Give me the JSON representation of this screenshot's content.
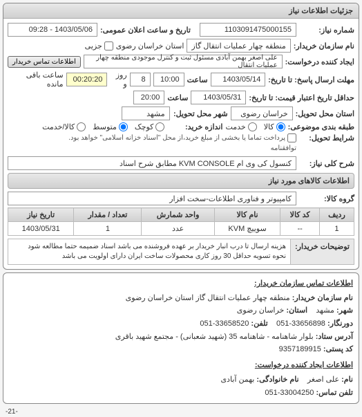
{
  "panel": {
    "title": "جزئیات اطلاعات نیاز"
  },
  "header": {
    "requestNumberLabel": "شماره نیاز:",
    "requestNumber": "1103091475000155",
    "announceDateLabel": "تاریخ و ساعت اعلان عمومی:",
    "announceDate": "1403/05/06 - 09:28",
    "buyerNameLabel": "نام سازمان خریدار:",
    "buyerName": "منطقه چهار عملیات انتقال گاز",
    "provinceLabel": "استان خراسان رضوی",
    "partialCheckbox": "جزیی",
    "requesterLabel": "ایجاد کننده درخواست:",
    "requester": "علی اصغر بهمن آبادی مسئول ثبت و کنترل موجودی منطقه چهار عملیات انتقال",
    "contactBtn": "اطلاعات تماس خریدار",
    "responseDeadlineLabel": "مهلت ارسال پاسخ: تا تاریخ:",
    "responseDeadlineDate": "1403/05/14",
    "timeLabel": "ساعت",
    "responseDeadlineTime": "10:00",
    "dayWord": "روز و",
    "dayValue": "8",
    "remainingTime": "00:20:20",
    "remainingLabel": "ساعت باقی مانده",
    "validityLabel": "حداقل تاریخ اعتبار قیمت: تا تاریخ:",
    "validityDate": "1403/05/31",
    "validityTime": "20:00",
    "deliveryProvinceLabel": "استان محل تحویل:",
    "deliveryProvince": "خراسان رضوی",
    "deliveryCityLabel": "شهر محل تحویل:",
    "deliveryCity": "مشهد",
    "packagingLabel": "طبقه بندی موضوعی:",
    "sizeLabel": "اندازه خرید:",
    "deliveryTermsLabel": "شرایط تحویل:",
    "radios": {
      "goods": "کالا",
      "services": "خدمت",
      "small": "کوچک",
      "medium": "متوسط",
      "large": "کالا/خدمت"
    },
    "paymentNote": "پرداخت تماما یا بخشی از مبلغ خرید،از محل \"اسناد خزانه اسلامی\" خواهد بود.",
    "agreementNote": "توافقنامه",
    "mainDescLabel": "شرح کلی نیاز:",
    "mainDesc": "کنسول کی وی ام KVM CONSOLE مطابق شرح اسناد"
  },
  "itemsSection": {
    "title": "اطلاعات کالاهای مورد نیاز",
    "categoryLabel": "گروه کالا:",
    "category": "کامپیوتر و فناوری اطلاعات-سخت افزار",
    "columns": {
      "row": "ردیف",
      "code": "کد کالا",
      "name": "نام کالا",
      "unit": "واحد شمارش",
      "qty": "تعداد / مقدار",
      "needDate": "تاریخ نیاز"
    },
    "rows": [
      {
        "row": "1",
        "code": "--",
        "name": "سوییچ KVM",
        "unit": "عدد",
        "qty": "1",
        "needDate": "1403/05/31"
      }
    ],
    "buyerNotesLabel": "توضیحات خریدار:",
    "buyerNotes": "هزینه ارسال تا درب انبار خریدار بر عهده فروشنده می باشد اسناد ضمیمه حتما مطالعه شود نحوه تسویه حداقل 30 روز کاری محصولات ساخت ایران دارای اولویت می باشد"
  },
  "contact": {
    "title": "اطلاعات تماس سازمان خریدار:",
    "orgLabel": "نام سازمان خریدار:",
    "org": "منطقه چهار عملیات انتقال گاز استان خراسان رضوی",
    "cityLabel": "شهر:",
    "city": "مشهد",
    "provinceLabel": "استان:",
    "province": "خراسان رضوی",
    "faxLabel": "دورنگار:",
    "fax": "051-33656898",
    "phoneLabel": "تلفن:",
    "phone": "051-33658520",
    "addressLabel": "آدرس ستاد:",
    "address": "بلوار شاهنامه - شاهنامه 35 (شهید شعبانی) - مجتمع شهید باقری",
    "postalLabel": "کد پستی:",
    "postal": "9357189915",
    "creatorTitle": "اطلاعات ایجاد کننده درخواست:",
    "nameLabel": "نام:",
    "firstName": "علی اصغر",
    "lastNameLabel": "نام خانوادگی:",
    "lastName": "بهمن آبادی",
    "contactPhoneLabel": "تلفن تماس:",
    "contactPhone": "051-33004250"
  },
  "footer": {
    "pageNum": "-21-"
  }
}
